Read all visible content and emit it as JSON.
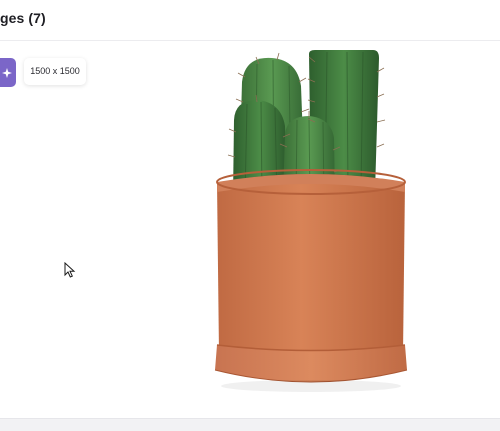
{
  "header": {
    "title": "ges (7)"
  },
  "toolbar": {
    "ai_icon": "sparkle-icon",
    "size_label": "1500 x 1500"
  },
  "image": {
    "subject": "cactus-in-terracotta-pot"
  },
  "colors": {
    "accent": "#7b66c8",
    "pot": "#c9734a",
    "cactus": "#3f7a3c"
  },
  "cursor": {
    "icon": "pointer-cursor-icon"
  }
}
